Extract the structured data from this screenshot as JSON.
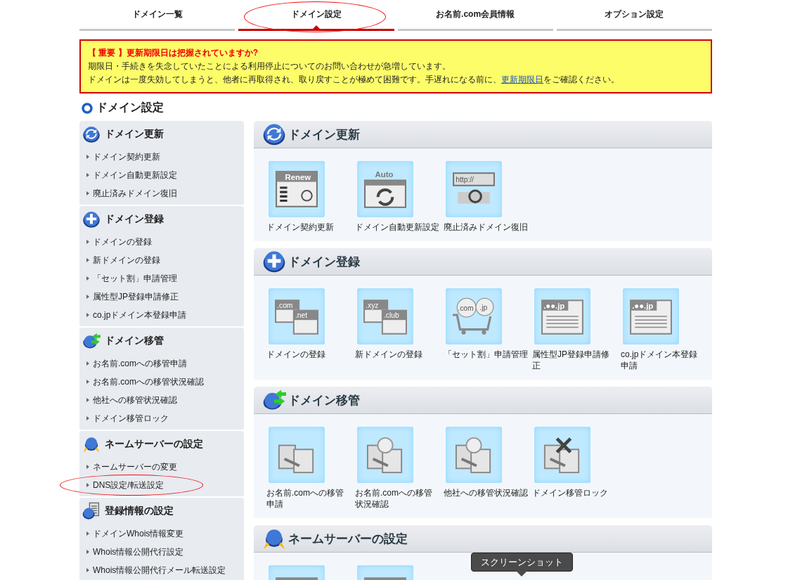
{
  "tabs": [
    {
      "label": "ドメイン一覧",
      "selected": false,
      "circled": false
    },
    {
      "label": "ドメイン設定",
      "selected": true,
      "circled": true
    },
    {
      "label": "お名前.com会員情報",
      "selected": false,
      "circled": false
    },
    {
      "label": "オプション設定",
      "selected": false,
      "circled": false
    }
  ],
  "notice": {
    "title": "【 重要 】更新期限日は把握されていますか?",
    "line_1": "期限日・手続きを失念していたことによる利用停止についてのお問い合わせが急増しています。",
    "line_2_before": "ドメインは一度失効してしまうと、他者に再取得され、取り戻すことが極めて困難です。手遅れになる前に、",
    "link": "更新期限日",
    "line_2_after": "をご確認ください。"
  },
  "page_title": "ドメイン設定",
  "sidebar": [
    {
      "title": "ドメイン更新",
      "kind": "renew",
      "items": [
        {
          "label": "ドメイン契約更新",
          "circled": false
        },
        {
          "label": "ドメイン自動更新設定",
          "circled": false
        },
        {
          "label": "廃止済みドメイン復旧",
          "circled": false
        }
      ]
    },
    {
      "title": "ドメイン登録",
      "kind": "add",
      "items": [
        {
          "label": "ドメインの登録",
          "circled": false
        },
        {
          "label": "新ドメインの登録",
          "circled": false
        },
        {
          "label": "「セット割」申請管理",
          "circled": false
        },
        {
          "label": "属性型JP登録申請修正",
          "circled": false
        },
        {
          "label": "co.jpドメイン本登録申請",
          "circled": false
        }
      ]
    },
    {
      "title": "ドメイン移管",
      "kind": "transfer",
      "items": [
        {
          "label": "お名前.comへの移管申請",
          "circled": false
        },
        {
          "label": "お名前.comへの移管状況確認",
          "circled": false
        },
        {
          "label": "他社への移管状況確認",
          "circled": false
        },
        {
          "label": "ドメイン移管ロック",
          "circled": false
        }
      ]
    },
    {
      "title": "ネームサーバーの設定",
      "kind": "nameserver",
      "items": [
        {
          "label": "ネームサーバーの変更",
          "circled": false
        },
        {
          "label": "DNS設定/転送設定",
          "circled": true
        }
      ]
    },
    {
      "title": "登録情報の設定",
      "kind": "registration",
      "items": [
        {
          "label": "ドメインWhois情報変更",
          "circled": false
        },
        {
          "label": "Whois情報公開代行設定",
          "circled": false
        },
        {
          "label": "Whois情報公開代行メール転送設定",
          "circled": false
        }
      ]
    }
  ],
  "sections": [
    {
      "title": "ドメイン更新",
      "kind": "renew",
      "tiles": [
        {
          "label": "ドメイン契約更新",
          "kind": "form",
          "caption": "Renew"
        },
        {
          "label": "ドメイン自動更新設定",
          "kind": "auto",
          "caption": "Auto"
        },
        {
          "label": "廃止済みドメイン復旧",
          "kind": "url",
          "caption": "http://"
        }
      ]
    },
    {
      "title": "ドメイン登録",
      "kind": "add",
      "tiles": [
        {
          "label": "ドメインの登録",
          "kind": "pair",
          "caption": ".com",
          "caption_2": ".net"
        },
        {
          "label": "新ドメインの登録",
          "kind": "pair",
          "caption": ".xyz",
          "caption_2": ".club"
        },
        {
          "label": "「セット割」申請管理",
          "kind": "cart",
          "caption": ".com",
          "caption_2": ".jp"
        },
        {
          "label": "属性型JP登録申請修正",
          "kind": "page",
          "caption": ".●●.jp"
        },
        {
          "label": "co.jpドメイン本登録申請",
          "kind": "page",
          "caption": ".●●.jp"
        }
      ]
    },
    {
      "title": "ドメイン移管",
      "kind": "transfer",
      "tiles": [
        {
          "label": "お名前.comへの移管申請",
          "kind": "servers"
        },
        {
          "label": "お名前.comへの移管状況確認",
          "kind": "search"
        },
        {
          "label": "他社への移管状況確認",
          "kind": "search"
        },
        {
          "label": "ドメイン移管ロック",
          "kind": "lock"
        }
      ]
    },
    {
      "title": "ネームサーバーの設定",
      "kind": "nameserver",
      "tiles": [
        {
          "kind": "window"
        },
        {
          "kind": "window"
        }
      ]
    }
  ],
  "tooltip": "スクリーンショット"
}
